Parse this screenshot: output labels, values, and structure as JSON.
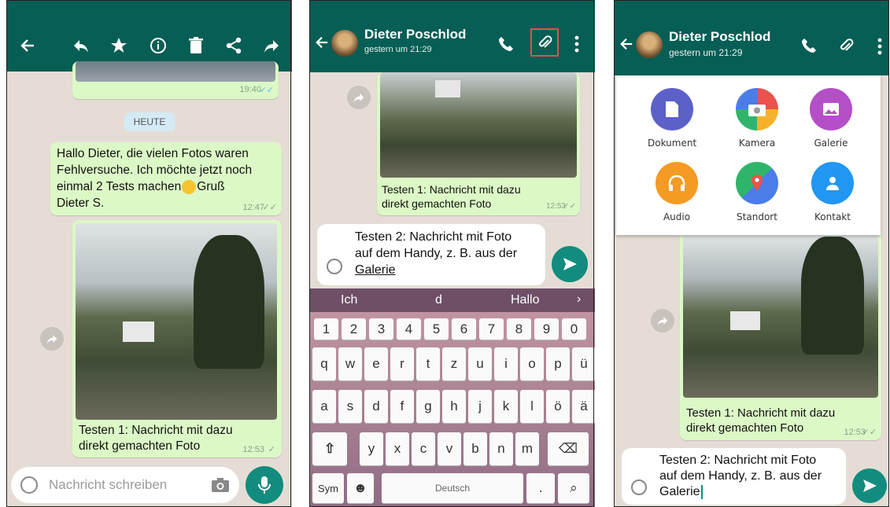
{
  "panel1": {
    "date_chip": "HEUTE",
    "top_bubble_time": "19:40",
    "msg1": {
      "line1": "Hallo Dieter, die vielen Fotos waren",
      "line2": "Fehlversuche. Ich möchte jetzt noch",
      "line3_a": "einmal  2 Tests machen",
      "line3_b": "Gruß",
      "line4": "Dieter S.",
      "time": "12:47"
    },
    "msg2": {
      "line1": "Testen 1: Nachricht mit dazu",
      "line2": "direkt gemachten Foto",
      "time": "12:53"
    },
    "input_placeholder": "Nachricht schreiben",
    "icons": [
      "back-arrow-icon",
      "reply-icon",
      "star-icon",
      "info-icon",
      "delete-icon",
      "share-icon",
      "forward-icon",
      "camera-icon",
      "mic-icon",
      "emoji-icon"
    ]
  },
  "panel2": {
    "contact_name": "Dieter Poschlod",
    "last_seen": "gestern um 21:29",
    "msg": {
      "line1": "Testen 1: Nachricht mit dazu",
      "line2": "direkt gemachten Foto",
      "time": "12:53"
    },
    "draft": {
      "line1": "Testen 2: Nachricht mit Foto",
      "line2": "auf dem Handy, z. B. aus der",
      "line3": "Galerie"
    },
    "suggestions": [
      "Ich",
      "d",
      "Hallo"
    ],
    "number_row": [
      "1",
      "2",
      "3",
      "4",
      "5",
      "6",
      "7",
      "8",
      "9",
      "0"
    ],
    "row1": [
      "q",
      "w",
      "e",
      "r",
      "t",
      "z",
      "u",
      "i",
      "o",
      "p",
      "ü"
    ],
    "row2": [
      "a",
      "s",
      "d",
      "f",
      "g",
      "h",
      "j",
      "k",
      "l",
      "ö",
      "ä"
    ],
    "row3": [
      "y",
      "x",
      "c",
      "v",
      "b",
      "n",
      "m"
    ],
    "sym_key": "Sym",
    "space_label": "Deutsch",
    "period_key": ".",
    "accent_color": "#d9534f"
  },
  "panel3": {
    "contact_name": "Dieter Poschlod",
    "last_seen": "gestern um 21:29",
    "attach": [
      {
        "label": "Dokument",
        "color": "#5c61c9",
        "icon": "document-icon"
      },
      {
        "label": "Kamera",
        "color": "#e8534a",
        "icon": "camera-icon"
      },
      {
        "label": "Galerie",
        "color": "#b44fc8",
        "icon": "gallery-icon"
      },
      {
        "label": "Audio",
        "color": "#f59a23",
        "icon": "headphones-icon"
      },
      {
        "label": "Standort",
        "color": "#2fb56a",
        "icon": "location-icon"
      },
      {
        "label": "Kontakt",
        "color": "#2196f3",
        "icon": "contact-icon"
      }
    ],
    "msg": {
      "line1": "Testen 1: Nachricht mit dazu",
      "line2": "direkt gemachten Foto",
      "time": "12:53"
    },
    "draft": {
      "line1": "Testen 2: Nachricht mit Foto",
      "line2": "auf dem Handy, z. B. aus der",
      "line3": "Galerie"
    }
  },
  "colors": {
    "header": "#075e54",
    "accent": "#128c7e",
    "bubble_out": "#dcf8c6",
    "chat_bg": "#e5ddd5"
  }
}
